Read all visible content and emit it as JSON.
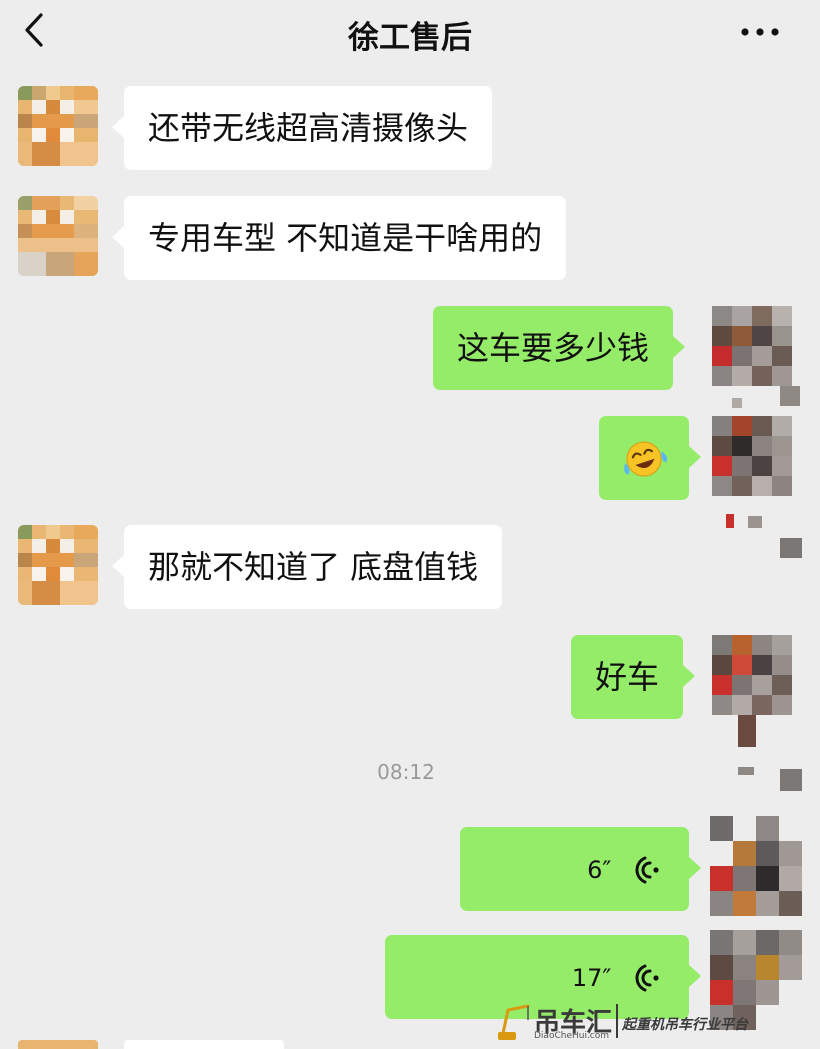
{
  "header": {
    "title": "徐工售后",
    "back_icon": "chevron-left-icon",
    "more_icon": "more-dots-icon"
  },
  "messages": [
    {
      "side": "in",
      "type": "text",
      "text": "还带无线超高清摄像头"
    },
    {
      "side": "in",
      "type": "text",
      "text": "专用车型  不知道是干啥用的"
    },
    {
      "side": "out",
      "type": "text",
      "text": "这车要多少钱"
    },
    {
      "side": "out",
      "type": "emoji",
      "emoji": "tears-of-joy-emoji"
    },
    {
      "side": "in",
      "type": "text",
      "text": "那就不知道了  底盘值钱"
    },
    {
      "side": "out",
      "type": "text",
      "text": "好车"
    },
    {
      "side": "out",
      "type": "voice",
      "duration": "6″"
    },
    {
      "side": "out",
      "type": "voice",
      "duration": "17″"
    }
  ],
  "timestamp": "08:12",
  "watermark": {
    "brand": "吊车汇",
    "domain": "DiaoCheHui.com",
    "slogan": "起重机吊车行业平台"
  },
  "colors": {
    "background": "#ededed",
    "incoming_bubble": "#ffffff",
    "outgoing_bubble": "#95ec69",
    "timestamp": "#9a9a9a"
  }
}
